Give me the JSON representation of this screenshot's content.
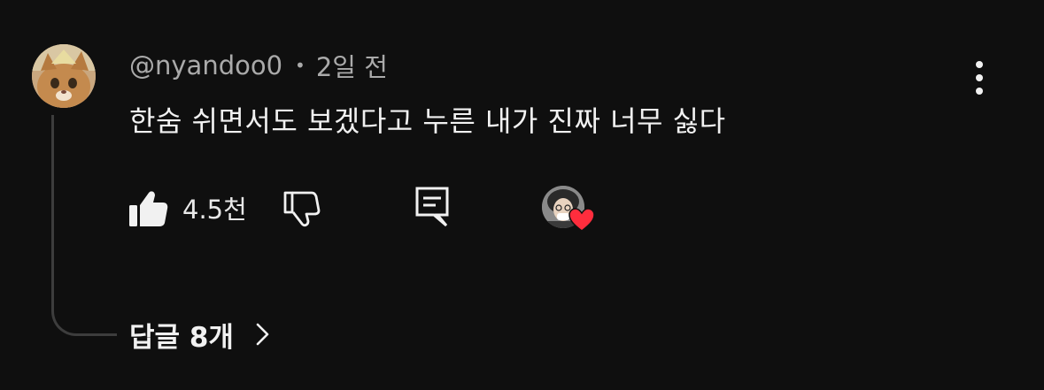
{
  "comment": {
    "author": "@nyandoo0",
    "separator": "•",
    "time": "2일 전",
    "text": "한숨 쉬면서도 보겠다고 누른 내가 진짜 너무 싫다",
    "like_count": "4.5천"
  },
  "replies": {
    "label": "답글 8개"
  },
  "icons": {
    "like": "thumbs-up-icon",
    "dislike": "thumbs-down-icon",
    "reply": "reply-icon",
    "more": "more-vertical-icon",
    "chevron": "chevron-right-icon",
    "heart": "heart-icon"
  },
  "colors": {
    "background": "#0f0f0f",
    "text_primary": "#f1f1f1",
    "text_secondary": "#aaaaaa",
    "heart": "#ff2d3d",
    "thread_line": "#3d3d3d"
  }
}
